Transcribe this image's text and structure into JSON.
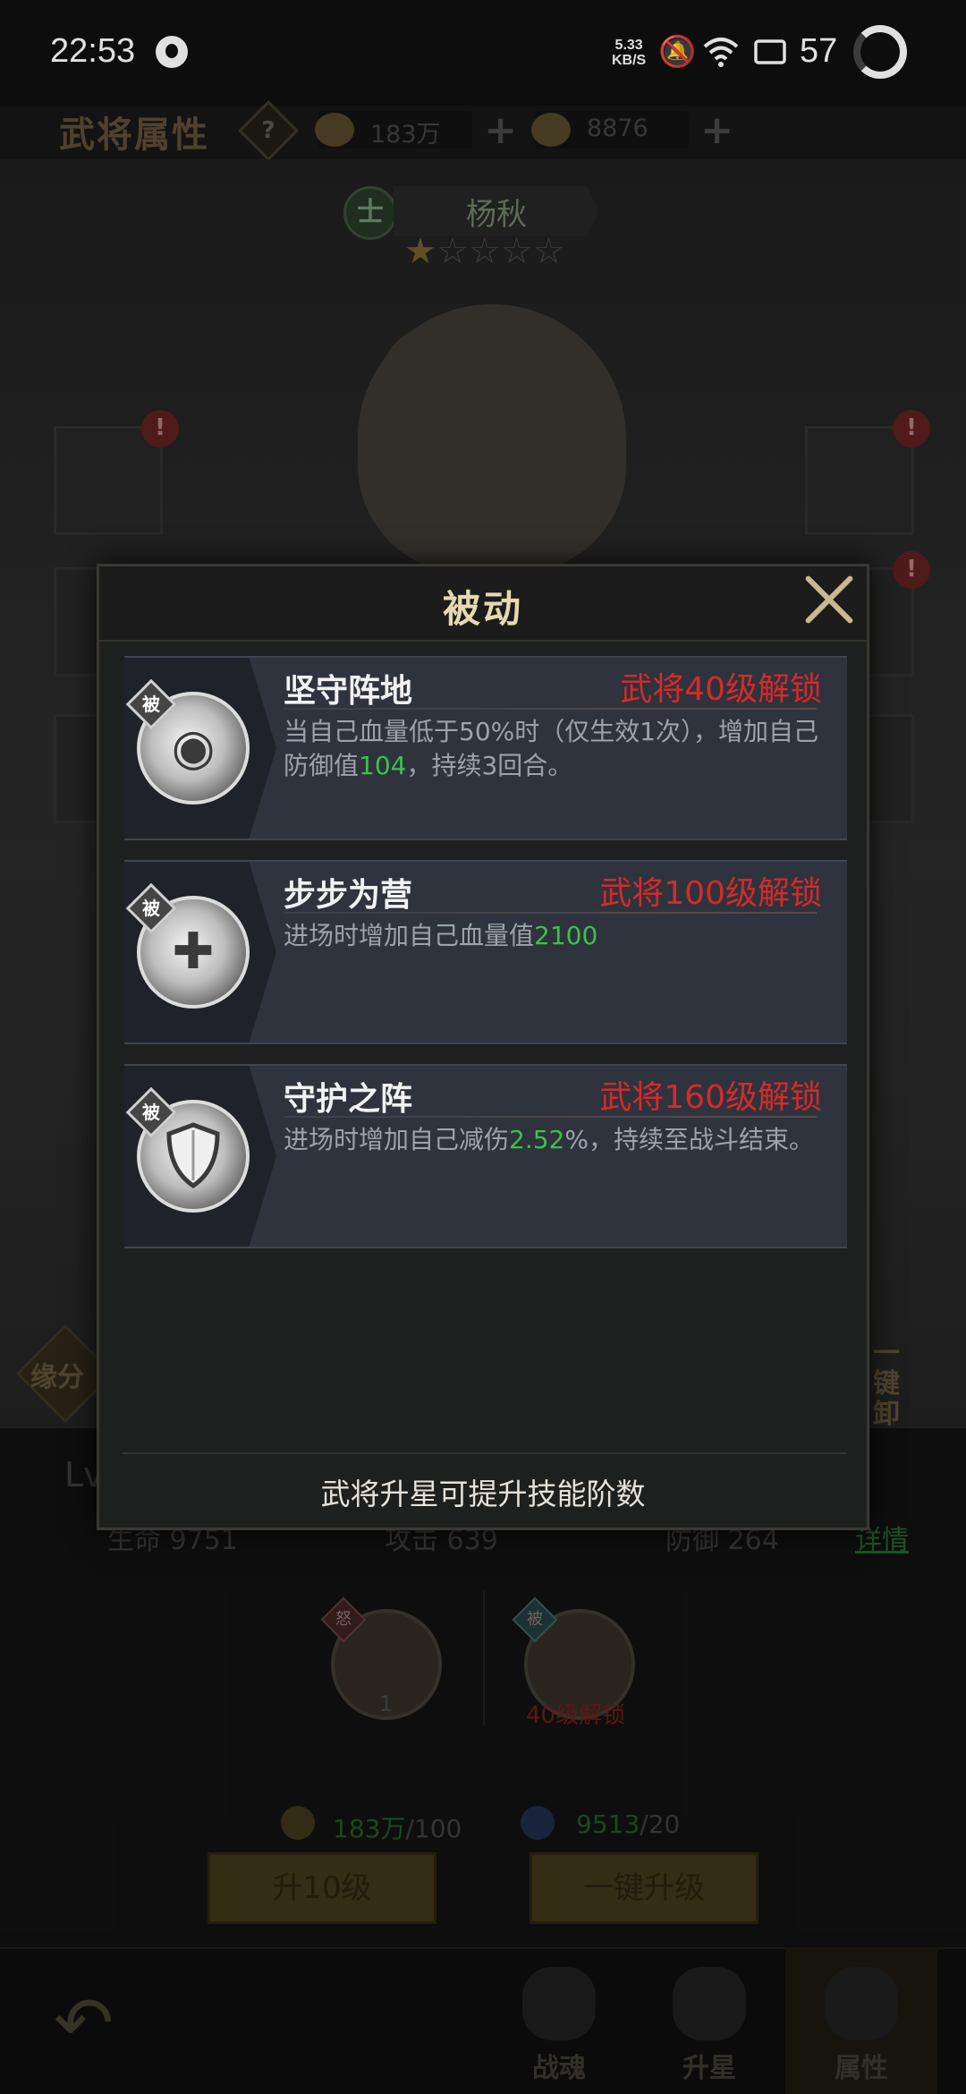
{
  "status_bar": {
    "time": "22:53",
    "net_speed_value": "5.33",
    "net_speed_unit": "KB/S",
    "battery": "57"
  },
  "header": {
    "title": "武将属性",
    "help_label": "?",
    "coins": "183万",
    "ingots": "8876",
    "plus": "+"
  },
  "hero": {
    "badge": "士",
    "name": "杨秋",
    "stars_filled": 1,
    "stars_total": 5,
    "alert": "!"
  },
  "side": {
    "left_label": "缘分",
    "right_label": "一键\n卸戴"
  },
  "stats": {
    "level_prefix": "Lv",
    "hp": "生命 9751",
    "atk": "攻击 639",
    "def": "防御 264",
    "detail_link": "详情",
    "slot1_tag": "怒",
    "slot1_level": "1",
    "slot2_tag": "被",
    "slot2_lock": "40级解锁",
    "cost_coin_value": "183万",
    "cost_coin_need": "/100",
    "cost_exp_value": "9513",
    "cost_exp_need": "/20",
    "btn_up10": "升10级",
    "btn_upall": "一键升级"
  },
  "bottom_nav": {
    "tabs": [
      {
        "label": "战魂"
      },
      {
        "label": "升星"
      },
      {
        "label": "属性"
      }
    ]
  },
  "modal": {
    "title": "被动",
    "footer": "武将升星可提升技能阶数",
    "skills": [
      {
        "tag": "被",
        "name": "坚守阵地",
        "lock": "武将40级解锁",
        "desc_pre": "当自己血量低于50%时（仅生效1次），增加自己防御值",
        "desc_num": "104",
        "desc_post": "，持续3回合。"
      },
      {
        "tag": "被",
        "name": "步步为营",
        "lock": "武将100级解锁",
        "desc_pre": "进场时增加自己血量值",
        "desc_num": "2100",
        "desc_post": ""
      },
      {
        "tag": "被",
        "name": "守护之阵",
        "lock": "武将160级解锁",
        "desc_pre": "进场时增加自己减伤",
        "desc_num": "2.52",
        "desc_post": "%，持续至战斗结束。"
      }
    ]
  }
}
